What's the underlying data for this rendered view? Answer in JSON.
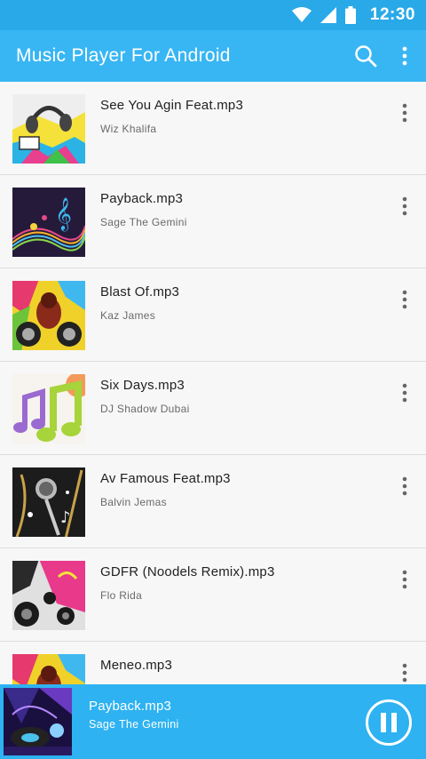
{
  "status_bar": {
    "time": "12:30"
  },
  "app_bar": {
    "title": "Music Player For Android"
  },
  "songs": [
    {
      "title": "See You Agin Feat.mp3",
      "artist": "Wiz Khalifa"
    },
    {
      "title": "Payback.mp3",
      "artist": "Sage The Gemini"
    },
    {
      "title": "Blast Of.mp3",
      "artist": "Kaz James"
    },
    {
      "title": "Six Days.mp3",
      "artist": "DJ Shadow Dubai"
    },
    {
      "title": "Av Famous Feat.mp3",
      "artist": "Balvin Jemas"
    },
    {
      "title": "GDFR (Noodels Remix).mp3",
      "artist": "Flo Rida"
    },
    {
      "title": "Meneo.mp3",
      "artist": ""
    }
  ],
  "now_playing": {
    "title": "Payback.mp3",
    "artist": "Sage The Gemini"
  },
  "colors": {
    "status_bar": "#29a9e8",
    "app_bar": "#38b6f3",
    "player": "#2eb2f1"
  }
}
